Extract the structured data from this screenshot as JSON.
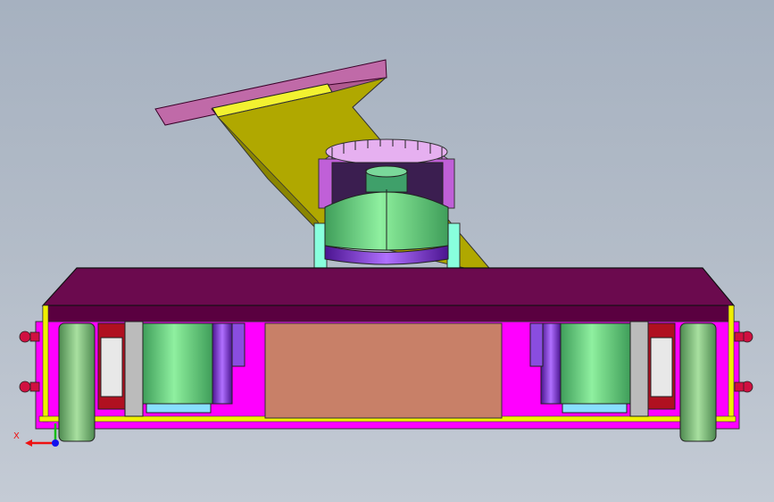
{
  "viewport": {
    "background_top": "#a6b1c0",
    "background_bottom": "#c4cbd5"
  },
  "model": {
    "colors": {
      "base_frame": "#ff00ff",
      "top_plate": "#6b0a4e",
      "top_plate_edge": "#3a0028",
      "bracket": "#b8b800",
      "bracket_highlight": "#f2f230",
      "rail_plate": "#c05a9a",
      "motor_green": "#6fe07f",
      "motor_purple": "#8a2be2",
      "wheel": "#8cce8c",
      "center_box": "#c88068",
      "bearing_red": "#d01030",
      "gear_grey": "#cccccc",
      "wire_yellow": "#f2f200"
    }
  },
  "triad": {
    "x_label": "X",
    "x_color": "#ee1111",
    "y_color": "#11bb11",
    "z_color": "#1111ee"
  }
}
